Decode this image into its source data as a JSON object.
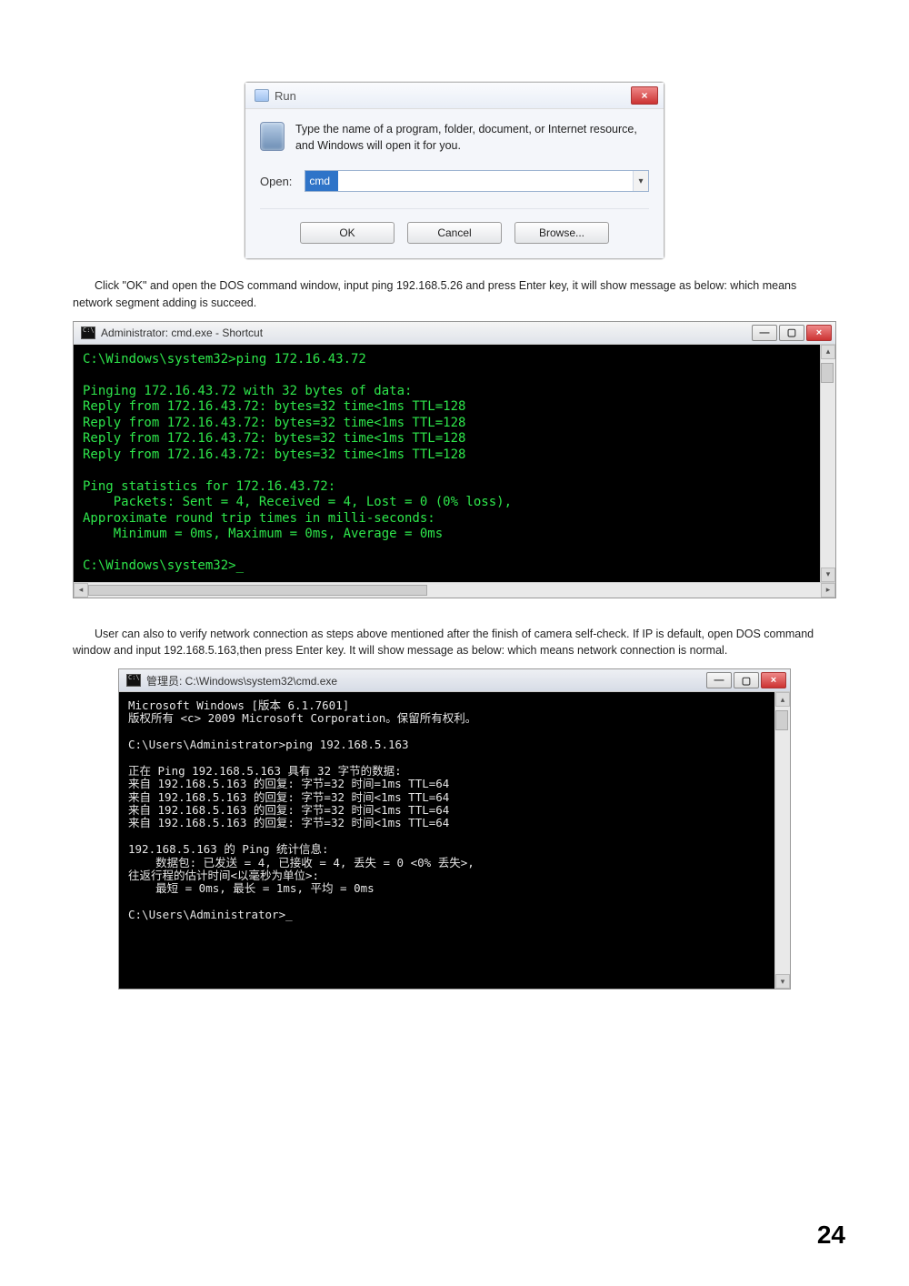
{
  "run_dialog": {
    "title": "Run",
    "close_glyph": "×",
    "description": "Type the name of a program, folder, document, or Internet resource, and Windows will open it for you.",
    "open_label": "Open:",
    "open_value": "cmd",
    "dropdown_glyph": "▾",
    "buttons": {
      "ok": "OK",
      "cancel": "Cancel",
      "browse": "Browse..."
    }
  },
  "para1": "Click \"OK\" and open the DOS command window, input ping 192.168.5.26 and press Enter key, it will show message as below: which means network segment adding is succeed.",
  "cmd1": {
    "title": "Administrator: cmd.exe - Shortcut",
    "lines": [
      "C:\\Windows\\system32>ping 172.16.43.72",
      "",
      "Pinging 172.16.43.72 with 32 bytes of data:",
      "Reply from 172.16.43.72: bytes=32 time<1ms TTL=128",
      "Reply from 172.16.43.72: bytes=32 time<1ms TTL=128",
      "Reply from 172.16.43.72: bytes=32 time<1ms TTL=128",
      "Reply from 172.16.43.72: bytes=32 time<1ms TTL=128",
      "",
      "Ping statistics for 172.16.43.72:",
      "    Packets: Sent = 4, Received = 4, Lost = 0 (0% loss),",
      "Approximate round trip times in milli-seconds:",
      "    Minimum = 0ms, Maximum = 0ms, Average = 0ms",
      "",
      "C:\\Windows\\system32>_"
    ]
  },
  "para2": "User can also to verify network connection as steps above mentioned after the finish of camera self-check. If IP is default, open DOS command window and input 192.168.5.163,then press Enter key. It will show message as below: which means network connection is normal.",
  "cmd2": {
    "title": "管理员: C:\\Windows\\system32\\cmd.exe",
    "lines": [
      "Microsoft Windows [版本 6.1.7601]",
      "版权所有 <c> 2009 Microsoft Corporation。保留所有权利。",
      "",
      "C:\\Users\\Administrator>ping 192.168.5.163",
      "",
      "正在 Ping 192.168.5.163 具有 32 字节的数据:",
      "来自 192.168.5.163 的回复: 字节=32 时间=1ms TTL=64",
      "来自 192.168.5.163 的回复: 字节=32 时间<1ms TTL=64",
      "来自 192.168.5.163 的回复: 字节=32 时间<1ms TTL=64",
      "来自 192.168.5.163 的回复: 字节=32 时间<1ms TTL=64",
      "",
      "192.168.5.163 的 Ping 统计信息:",
      "    数据包: 已发送 = 4, 已接收 = 4, 丢失 = 0 <0% 丢失>,",
      "往返行程的估计时间<以毫秒为单位>:",
      "    最短 = 0ms, 最长 = 1ms, 平均 = 0ms",
      "",
      "C:\\Users\\Administrator>_"
    ]
  },
  "win_controls": {
    "min": "—",
    "max": "▢",
    "close": "×"
  },
  "scroll": {
    "up": "▴",
    "down": "▾",
    "left": "◂",
    "right": "▸"
  },
  "page_number": "24"
}
